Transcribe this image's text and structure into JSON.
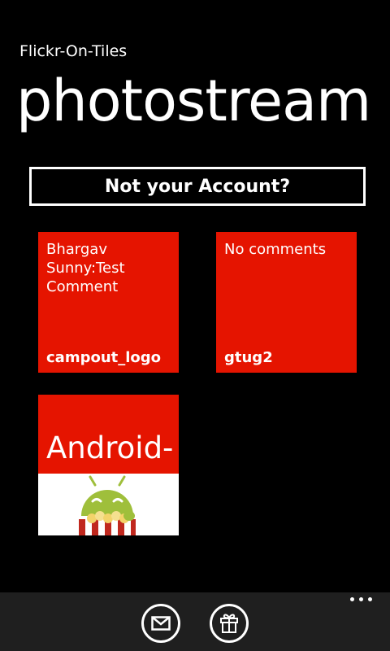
{
  "app": {
    "title": "Flickr-On-Tiles",
    "page_title": "photostream"
  },
  "account_button": {
    "label": "Not your Account?"
  },
  "tiles": [
    {
      "comment": "Bhargav Sunny:Test Comment",
      "name": "campout_logo"
    },
    {
      "comment": "No comments",
      "name": "gtug2"
    },
    {
      "text": "Android-"
    }
  ],
  "app_bar": {
    "buttons": [
      "mail-icon",
      "gift-icon"
    ],
    "more": "more-icon"
  },
  "colors": {
    "background": "#000000",
    "accent": "#e51400",
    "app_bar": "#1f1f1f",
    "android_green": "#9fbf3b"
  }
}
